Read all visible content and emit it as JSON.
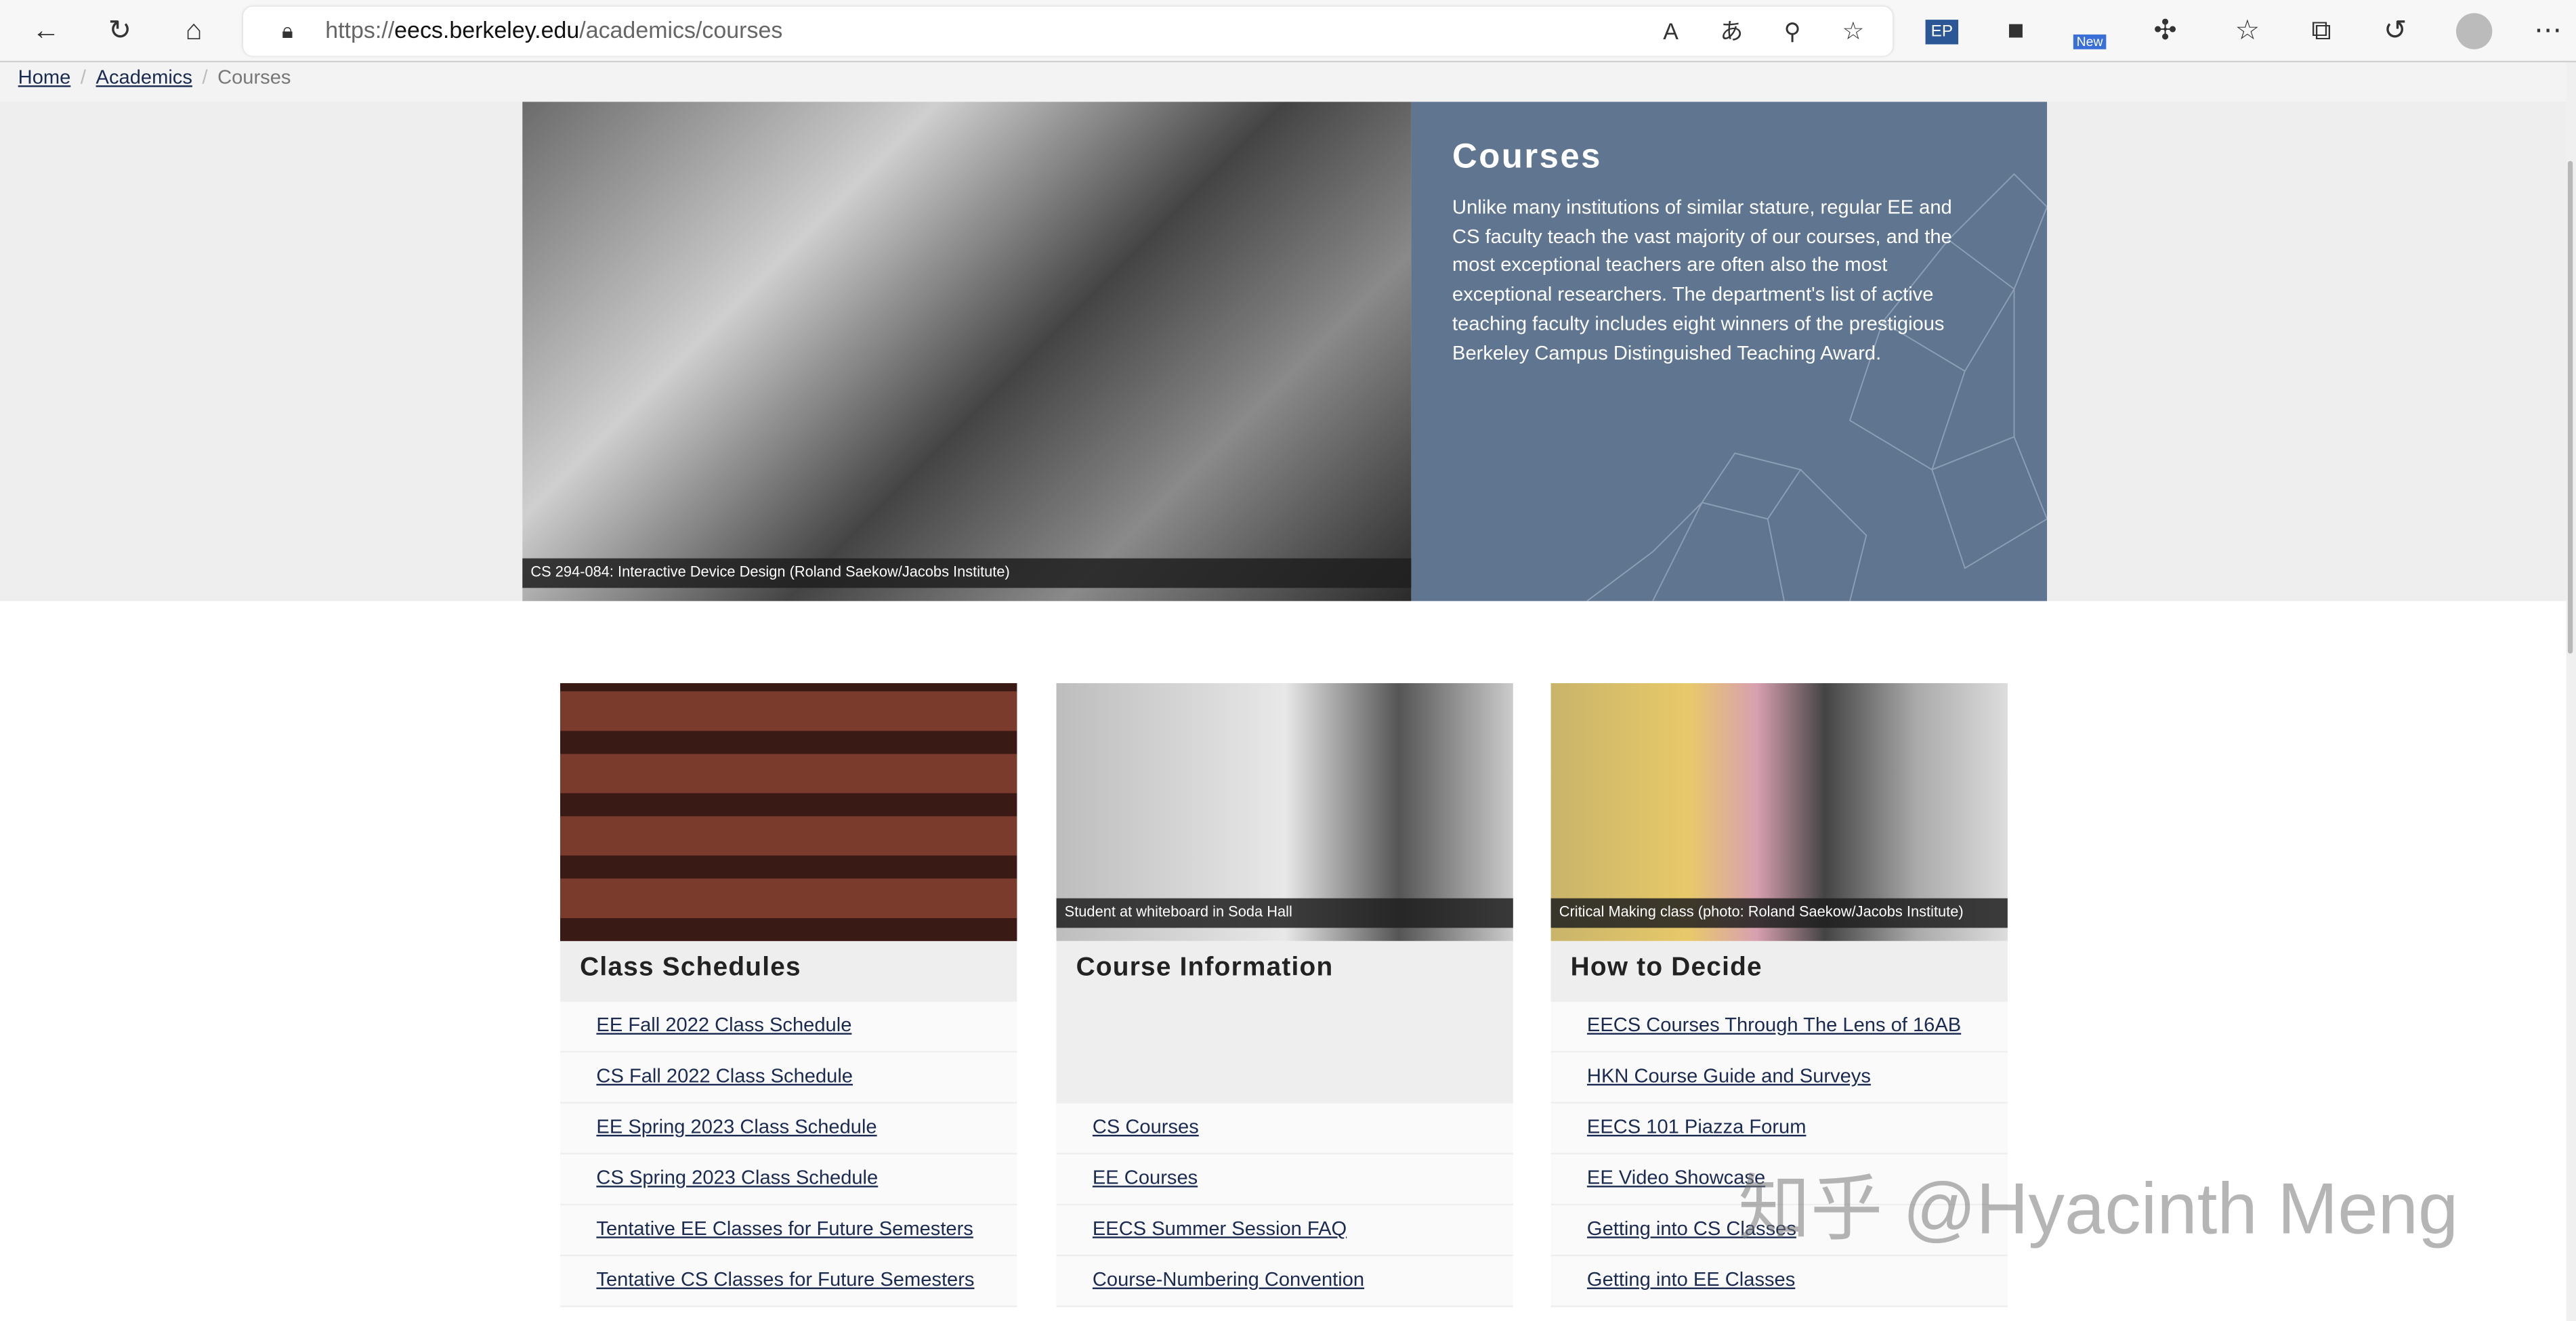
{
  "browser": {
    "url_prefix": "https://",
    "url_host": "eecs.berkeley.edu",
    "url_path": "/academics/courses",
    "new_badge": "New"
  },
  "breadcrumb": {
    "items": [
      "Home",
      "Academics"
    ],
    "current": "Courses"
  },
  "hero": {
    "title": "Courses",
    "body": "Unlike many institutions of similar stature, regular EE and CS faculty teach the vast majority of our courses, and the most exceptional teachers are often also the most exceptional researchers. The department's list of active teaching faculty includes eight winners of the prestigious Berkeley Campus Distinguished Teaching Award.",
    "caption": "CS 294-084: Interactive Device Design (Roland Saekow/Jacobs Institute)",
    "color": "#5f7590"
  },
  "cards": [
    {
      "title": "Class Schedules",
      "caption": "",
      "links": [
        "EE Fall 2022 Class Schedule",
        "CS Fall 2022 Class Schedule",
        "EE Spring 2023 Class Schedule",
        "CS Spring 2023 Class Schedule",
        "Tentative EE Classes for Future Semesters",
        "Tentative CS Classes for Future Semesters"
      ]
    },
    {
      "title": "Course Information",
      "caption": "Student at whiteboard in Soda Hall",
      "links": [
        "CS Courses",
        "EE Courses",
        "EECS Summer Session FAQ",
        "Course-Numbering Convention"
      ]
    },
    {
      "title": "How to Decide",
      "caption": "Critical Making class (photo: Roland Saekow/Jacobs Institute)",
      "links": [
        "EECS Courses Through The Lens of 16AB",
        "HKN Course Guide and Surveys",
        "EECS 101 Piazza Forum",
        "EE Video Showcase",
        "Getting into CS Classes",
        "Getting into EE Classes"
      ]
    }
  ],
  "watermark": "知乎 @Hyacinth Meng"
}
